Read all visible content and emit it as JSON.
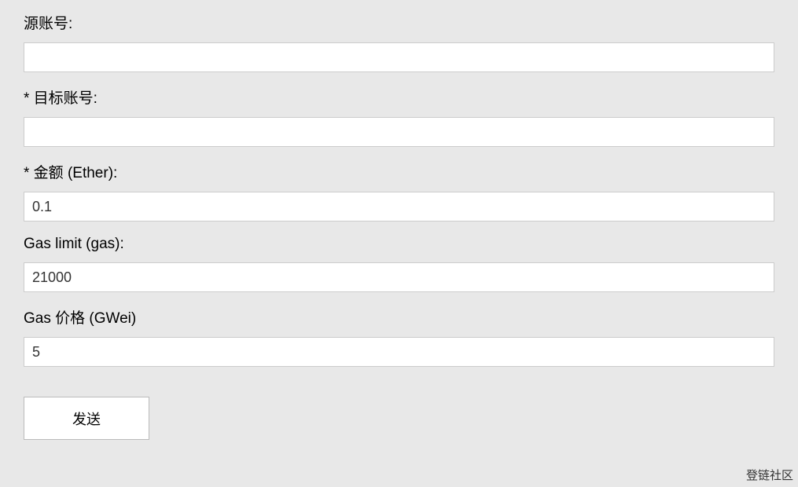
{
  "form": {
    "sourceAccount": {
      "label": "源账号:",
      "value": ""
    },
    "targetAccount": {
      "label": "* 目标账号:",
      "value": ""
    },
    "amount": {
      "label": "* 金额 (Ether):",
      "value": "0.1"
    },
    "gasLimit": {
      "label": "Gas limit (gas):",
      "value": "21000"
    },
    "gasPrice": {
      "label": "Gas 价格 (GWei)",
      "value": "5"
    },
    "submitLabel": "发送"
  },
  "watermark": "登链社区"
}
